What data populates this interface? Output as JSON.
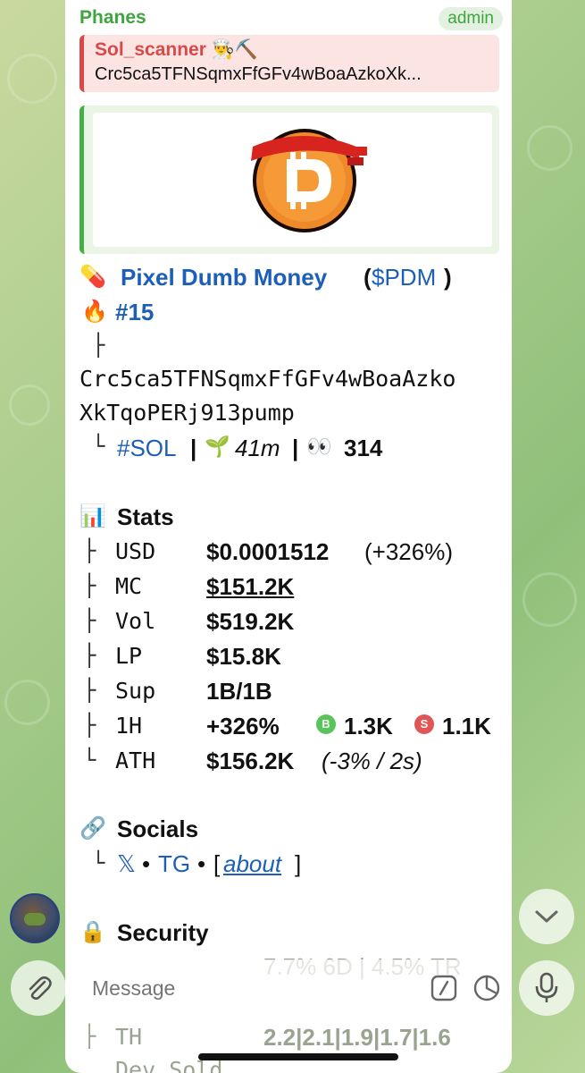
{
  "message": {
    "sender": "Phanes",
    "role_badge": "admin",
    "reply": {
      "name": "Sol_scanner",
      "emoji": "👨‍🍳⛏️",
      "text": "Crc5ca5TFNSqmxFfGFv4wBoaAzkoXk..."
    },
    "token": {
      "pill_icon": "pill-icon",
      "name": "Pixel Dumb Money",
      "open_paren": "(",
      "ticker": "$PDM",
      "close_paren": ")",
      "rank": "#15",
      "tree_branch": "├",
      "tree_end": "└",
      "address_line1": "Crc5ca5TFNSqmxFfGFv4wBoaAzko",
      "address_line2": "XkTqoPERj913pump",
      "chain": "#SOL",
      "separator": "|",
      "age": "41m",
      "views": "314"
    },
    "stats": {
      "title": "Stats",
      "rows": [
        {
          "label": "USD",
          "value": "$0.0001512",
          "extra": "(+326%)"
        },
        {
          "label": "MC",
          "value": "$151.2K"
        },
        {
          "label": "Vol",
          "value": "$519.2K"
        },
        {
          "label": "LP",
          "value": "$15.8K"
        },
        {
          "label": "Sup",
          "value": "1B/1B"
        },
        {
          "label": "1H",
          "value": "+326%",
          "buy_badge": "B",
          "buys": "1.3K",
          "sell_badge": "S",
          "sells": "1.1K"
        },
        {
          "label": "ATH",
          "value": "$156.2K",
          "extra": "(-3% / 2s)"
        }
      ]
    },
    "socials": {
      "title": "Socials",
      "x_link": "𝕏",
      "bullet": "•",
      "tg_link": "TG",
      "open_bracket": "[",
      "about_link": "about",
      "close_bracket": "]"
    },
    "security": {
      "title": "Security",
      "partial_row1": "7.7% 6D | 4.5% TR",
      "th_label": "TH",
      "th_value": "2.2|2.1|1.9|1.7|1.6",
      "dev_label": "Dev Sold"
    }
  },
  "composer": {
    "placeholder": "Message"
  },
  "colors": {
    "sender_green": "#3fa53f",
    "link_blue": "#1d5fb8",
    "reply_red": "#d84a4a",
    "buy_green": "#58c45a",
    "sell_red": "#e05555"
  }
}
